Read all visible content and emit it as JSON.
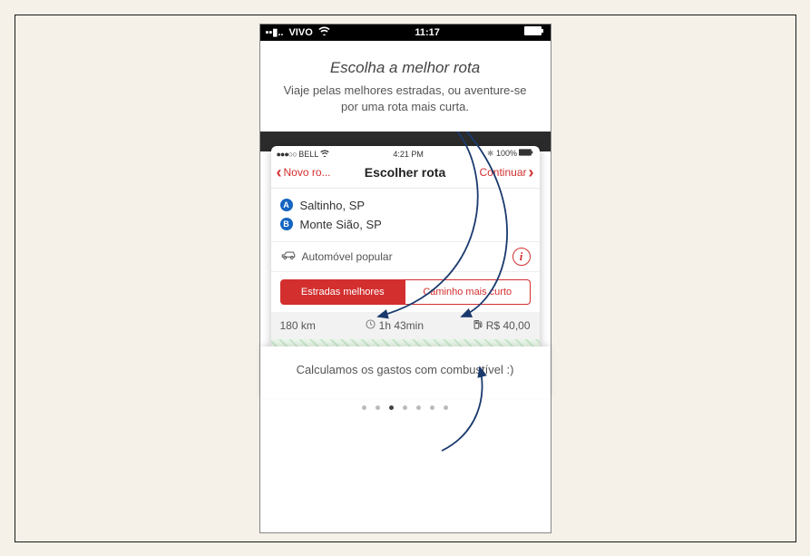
{
  "outer_status": {
    "carrier": "VIVO",
    "time": "11:17"
  },
  "intro": {
    "title": "Escolha a melhor rota",
    "subtitle": "Viaje pelas melhores estradas, ou aventure-se por uma rota mais curta."
  },
  "inner_status": {
    "carrier": "BELL",
    "time": "4:21 PM",
    "battery": "100%"
  },
  "nav": {
    "back": "Novo ro...",
    "title": "Escolher rota",
    "forward": "Continuar"
  },
  "locations": {
    "a": "Saltinho, SP",
    "b": "Monte Sião, SP"
  },
  "vehicle": {
    "label": "Automóvel popular"
  },
  "segments": {
    "best": "Estradas melhores",
    "short": "Caminho mais curto"
  },
  "stats": {
    "distance": "180 km",
    "time": "1h 43min",
    "cost": "R$ 40,00"
  },
  "footer": {
    "text": "Calculamos os gastos com combustível :)"
  }
}
